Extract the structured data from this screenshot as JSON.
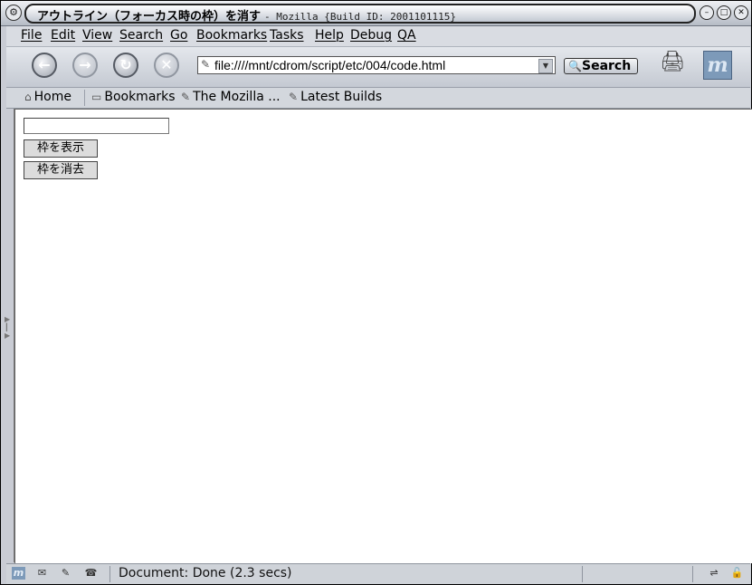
{
  "window": {
    "title": "アウトライン（フォーカス時の枠）を消す",
    "title_suffix": "- Mozilla {Build ID: 2001101115}"
  },
  "menu": {
    "file": "File",
    "edit": "Edit",
    "view": "View",
    "search": "Search",
    "go": "Go",
    "bookmarks": "Bookmarks",
    "tasks": "Tasks",
    "help": "Help",
    "debug": "Debug",
    "qa": "QA"
  },
  "navbar": {
    "url": "file:////mnt/cdrom/script/etc/004/code.html",
    "search_label": "Search"
  },
  "personal": {
    "home": "Home",
    "bookmarks": "Bookmarks",
    "mozilla": "The Mozilla ...",
    "latest": "Latest Builds"
  },
  "page": {
    "input_value": "",
    "show_outline_button": "枠を表示",
    "hide_outline_button": "枠を消去"
  },
  "status": {
    "text": "Document: Done (2.3 secs)"
  },
  "icons": {
    "window_menu": "mozilla-window-icon",
    "back": "back-arrow-icon",
    "forward": "forward-arrow-icon",
    "reload": "reload-icon",
    "stop": "stop-icon",
    "throbber": "mozilla-m-logo-icon"
  }
}
